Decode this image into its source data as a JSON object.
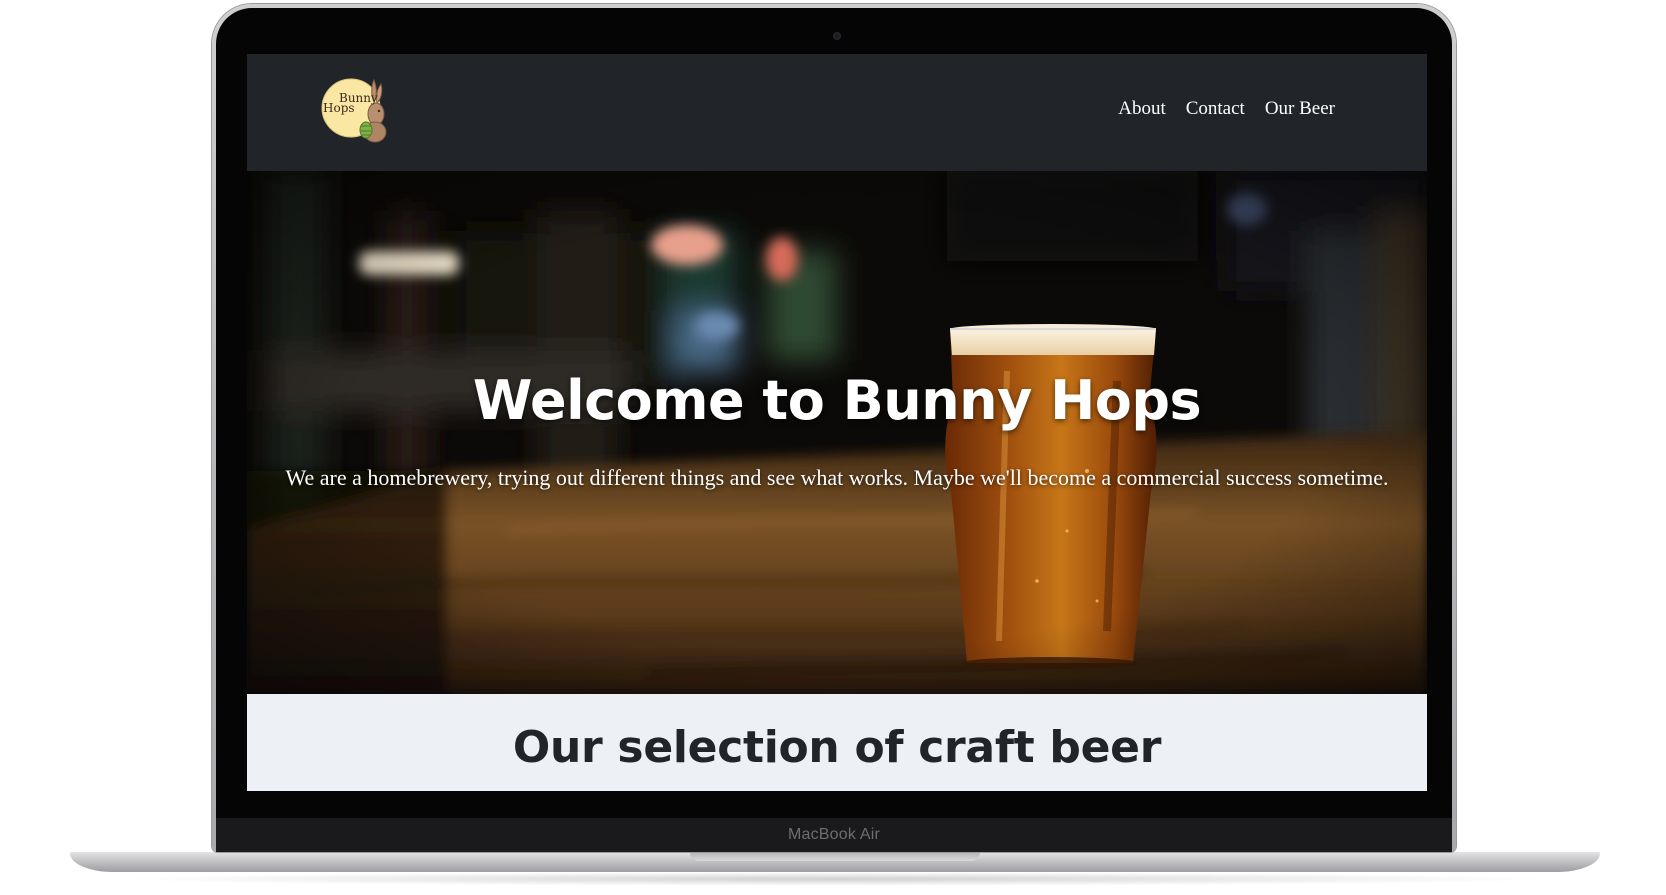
{
  "device": {
    "model_label": "MacBook Air"
  },
  "site": {
    "logo": {
      "text_line1": "Bunny",
      "text_line2": "Hops",
      "icon": "rabbit-with-hops-logo"
    },
    "nav": {
      "items": [
        {
          "label": "About"
        },
        {
          "label": "Contact"
        },
        {
          "label": "Our Beer"
        }
      ]
    },
    "hero": {
      "title": "Welcome to Bunny Hops",
      "tagline": "We are a homebrewery, trying out different things and see what works. Maybe we'll become a commercial success sometime.",
      "image": "pint-of-beer-on-wooden-bar-photo"
    },
    "selection": {
      "title": "Our selection of craft beer"
    }
  },
  "colors": {
    "navbar_bg": "#212529",
    "nav_text": "#ffffff",
    "section_bg": "#edf1f5",
    "heading_dark": "#212529"
  }
}
